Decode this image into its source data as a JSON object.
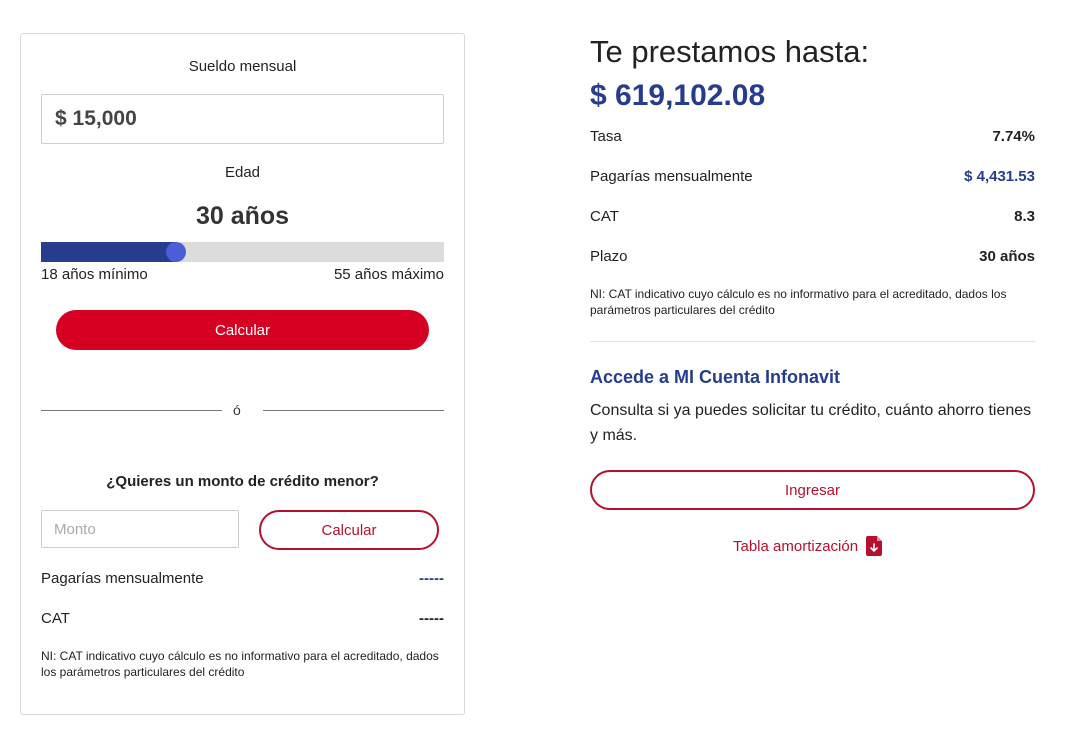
{
  "calculator": {
    "salary_label": "Sueldo mensual",
    "salary_value": "$ 15,000",
    "age_label": "Edad",
    "age_value": "30 años",
    "age_slider": {
      "min": 18,
      "max": 55,
      "value": 30
    },
    "age_min_label": "18 años mínimo",
    "age_max_label": "55 años máximo",
    "calculate_label": "Calcular",
    "divider_text": "ó",
    "lower_question": "¿Quieres un monto de crédito menor?",
    "monto_placeholder": "Monto",
    "calculate2_label": "Calcular",
    "monthly_label": "Pagarías mensualmente",
    "monthly_value": "-----",
    "cat_label": "CAT",
    "cat_value": "-----",
    "note": "NI: CAT indicativo cuyo cálculo es no informativo para el acreditado, dados los parámetros particulares del crédito"
  },
  "result": {
    "title": "Te prestamos hasta:",
    "amount": "$ 619,102.08",
    "rows": [
      {
        "label": "Tasa",
        "value": "7.74%"
      },
      {
        "label": "Pagarías mensualmente",
        "value": "$ 4,431.53"
      },
      {
        "label": "CAT",
        "value": "8.3"
      },
      {
        "label": "Plazo",
        "value": "30 años"
      }
    ],
    "note": "NI: CAT indicativo cuyo cálculo es no informativo para el acreditado, dados los parámetros particulares del crédito",
    "account_title": "Accede a MI Cuenta Infonavit",
    "account_desc": "Consulta si ya puedes solicitar tu crédito, cuánto ahorro tienes y más.",
    "login_label": "Ingresar",
    "amortization_label": "Tabla amortización"
  },
  "colors": {
    "brand_blue": "#263d8e",
    "brand_red": "#d50022",
    "outline_red": "#b3122f",
    "slider_thumb": "#4a5ed8"
  },
  "icons": {
    "amortization": "pdf-download-icon"
  }
}
